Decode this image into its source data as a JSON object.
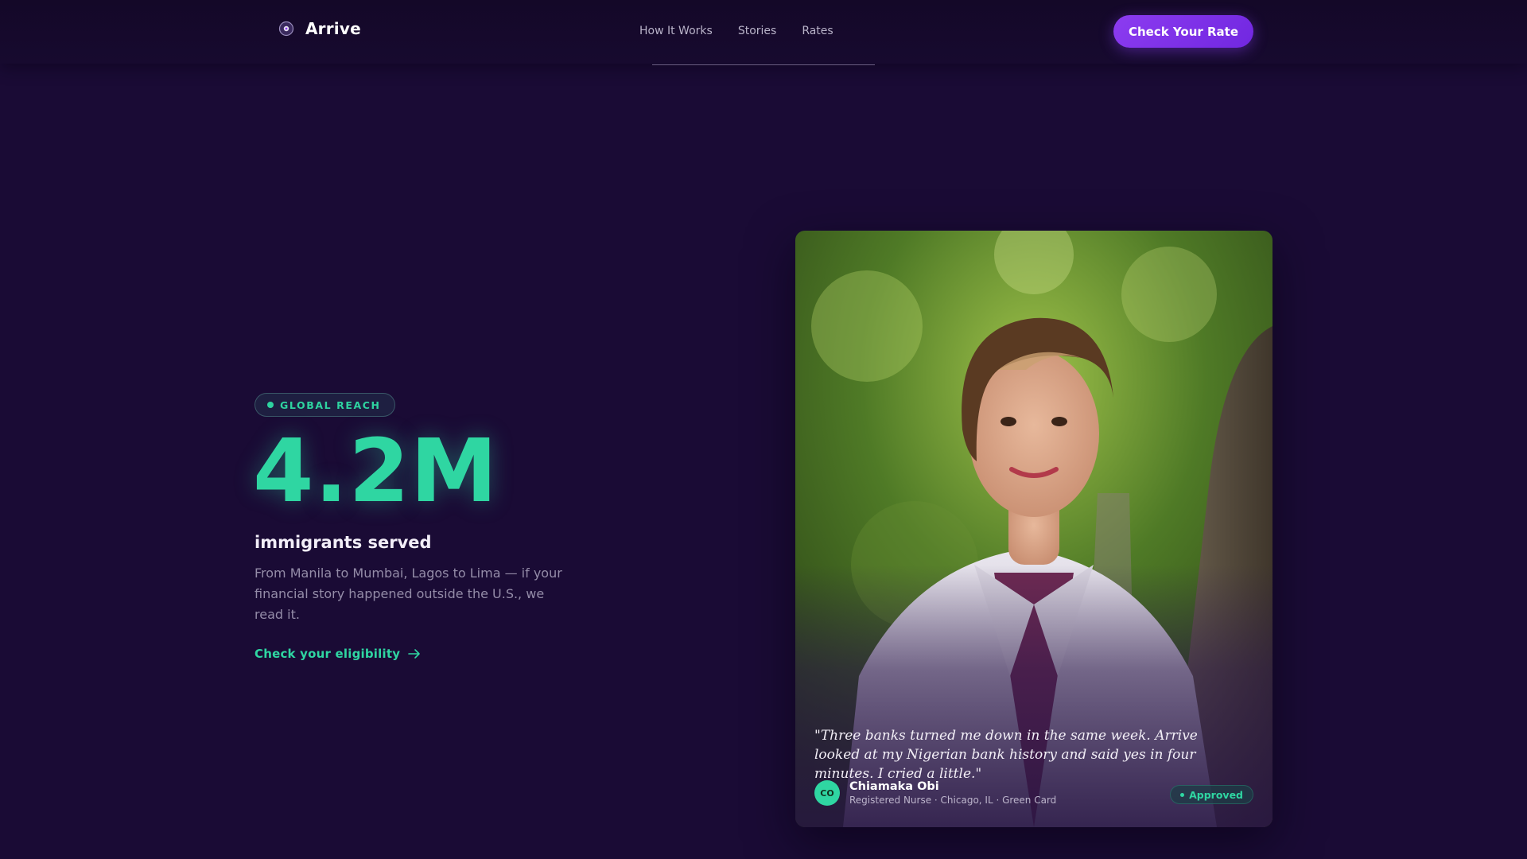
{
  "header": {
    "brand_name": "Arrive",
    "brand_icon": "globe-compass-icon",
    "nav": [
      "How It Works",
      "Stories",
      "Rates"
    ],
    "cta_label": "Check Your Rate"
  },
  "hero": {
    "badge": "GLOBAL REACH",
    "stat_value": "4.2M",
    "stat_label": "immigrants served",
    "description": "From Manila to Mumbai, Lagos to Lima — if your financial story happened outside the U.S., we read it.",
    "link_label": "Check your eligibility",
    "link_icon": "arrow-right-icon"
  },
  "testimonial": {
    "quote": "\"Three banks turned me down in the same week. Arrive looked at my Nigerian bank history and said yes in four minutes. I cried a little.\"",
    "avatar_initials": "CO",
    "name": "Chiamaka Obi",
    "meta": "Registered Nurse · Chicago, IL · Green Card",
    "status": "Approved"
  },
  "colors": {
    "background": "#1a0b35",
    "accent_green": "#2fd6a2",
    "accent_purple": "#7f33ea"
  }
}
